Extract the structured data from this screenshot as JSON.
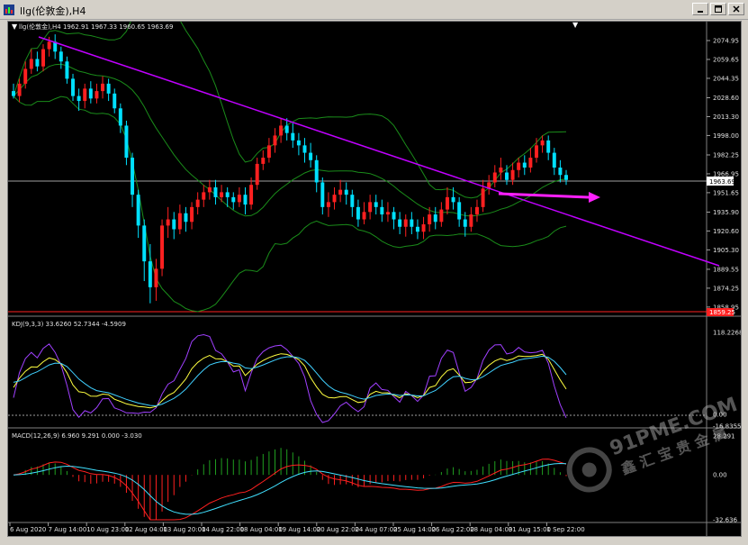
{
  "window": {
    "title": "llg(伦敦金),H4"
  },
  "header": {
    "symbol_info": "llg(伦敦金),H4  1962.91 1967.33 1960.65 1963.69"
  },
  "price_axis": {
    "ticks": [
      "2074.95",
      "2059.65",
      "2044.35",
      "2028.60",
      "2013.30",
      "1998.00",
      "1982.25",
      "1966.95",
      "1951.65",
      "1935.90",
      "1920.60",
      "1905.30",
      "1889.55",
      "1874.25",
      "1858.95"
    ],
    "current_price": "1963.69",
    "lower_red_label": "1859.25"
  },
  "time_axis": {
    "ticks": [
      "6 Aug 2020",
      "7 Aug 14:00",
      "10 Aug 23:00",
      "12 Aug 04:00",
      "13 Aug 20:00",
      "14 Aug 22:00",
      "18 Aug 04:00",
      "19 Aug 14:00",
      "20 Aug 22:00",
      "24 Aug 07:00",
      "25 Aug 14:00",
      "26 Aug 22:00",
      "28 Aug 04:00",
      "31 Aug 15:00",
      "1 Sep 22:00"
    ]
  },
  "kdj": {
    "label": "KDJ(9,3,3) 33.6260 52.7344 -4.5909",
    "ticks": [
      "118.2268",
      "0.00",
      "-16.8355"
    ]
  },
  "macd": {
    "label": "MACD(12,26,9) 6.960 9.291 0.000 -3.030",
    "ticks": [
      "28.291",
      "0.00",
      "-32.636"
    ]
  },
  "watermark": {
    "line1": "91PME.COM",
    "line2": "鑫 汇 宝 贵 金 属"
  },
  "colors": {
    "background": "#000000",
    "bull": "#ff2020",
    "bear": "#00e0ff",
    "trendline": "#c000ff",
    "arrow": "#ff20ff",
    "bands": "#1a8c1a",
    "k_line": "#ffff40",
    "d_line": "#40d0ff",
    "j_line": "#a040ff",
    "macd_line": "#ff2020",
    "signal_line": "#40e0ff",
    "hist_pos": "#20a020",
    "hist_neg": "#ff2020"
  },
  "candles": [
    [
      2034,
      2030,
      2040,
      2028
    ],
    [
      2030,
      2040,
      2044,
      2025
    ],
    [
      2040,
      2052,
      2058,
      2036
    ],
    [
      2052,
      2060,
      2068,
      2048
    ],
    [
      2060,
      2054,
      2066,
      2050
    ],
    [
      2054,
      2068,
      2072,
      2050
    ],
    [
      2068,
      2074,
      2078,
      2062
    ],
    [
      2074,
      2066,
      2080,
      2060
    ],
    [
      2066,
      2058,
      2070,
      2052
    ],
    [
      2058,
      2044,
      2062,
      2040
    ],
    [
      2044,
      2030,
      2048,
      2026
    ],
    [
      2030,
      2026,
      2036,
      2018
    ],
    [
      2026,
      2036,
      2040,
      2020
    ],
    [
      2036,
      2028,
      2042,
      2024
    ],
    [
      2028,
      2034,
      2040,
      2024
    ],
    [
      2034,
      2040,
      2046,
      2028
    ],
    [
      2040,
      2032,
      2044,
      2026
    ],
    [
      2032,
      2020,
      2036,
      2016
    ],
    [
      2020,
      2006,
      2024,
      2000
    ],
    [
      2006,
      1980,
      2010,
      1974
    ],
    [
      1980,
      1950,
      1984,
      1940
    ],
    [
      1950,
      1925,
      1954,
      1915
    ],
    [
      1925,
      1896,
      1930,
      1880
    ],
    [
      1896,
      1875,
      1910,
      1862
    ],
    [
      1875,
      1890,
      1898,
      1864
    ],
    [
      1890,
      1925,
      1930,
      1884
    ],
    [
      1925,
      1930,
      1940,
      1915
    ],
    [
      1930,
      1922,
      1936,
      1914
    ],
    [
      1922,
      1935,
      1942,
      1918
    ],
    [
      1935,
      1928,
      1940,
      1920
    ],
    [
      1928,
      1940,
      1944,
      1922
    ],
    [
      1940,
      1946,
      1952,
      1934
    ],
    [
      1946,
      1952,
      1958,
      1940
    ],
    [
      1952,
      1956,
      1962,
      1946
    ],
    [
      1956,
      1948,
      1962,
      1942
    ],
    [
      1948,
      1952,
      1958,
      1944
    ],
    [
      1952,
      1948,
      1956,
      1940
    ],
    [
      1948,
      1944,
      1952,
      1938
    ],
    [
      1944,
      1950,
      1956,
      1940
    ],
    [
      1950,
      1942,
      1956,
      1934
    ],
    [
      1942,
      1958,
      1964,
      1938
    ],
    [
      1958,
      1975,
      1980,
      1954
    ],
    [
      1975,
      1980,
      1986,
      1970
    ],
    [
      1980,
      1990,
      1996,
      1976
    ],
    [
      1990,
      1998,
      2004,
      1984
    ],
    [
      1998,
      2006,
      2012,
      1992
    ],
    [
      2006,
      2000,
      2012,
      1994
    ],
    [
      2000,
      1994,
      2008,
      1988
    ],
    [
      1994,
      1990,
      2000,
      1982
    ],
    [
      1990,
      1984,
      1996,
      1976
    ],
    [
      1984,
      1978,
      1992,
      1972
    ],
    [
      1978,
      1960,
      1982,
      1952
    ],
    [
      1960,
      1940,
      1964,
      1934
    ],
    [
      1940,
      1944,
      1952,
      1932
    ],
    [
      1944,
      1950,
      1956,
      1938
    ],
    [
      1950,
      1954,
      1962,
      1944
    ],
    [
      1954,
      1950,
      1960,
      1942
    ],
    [
      1950,
      1940,
      1954,
      1932
    ],
    [
      1940,
      1930,
      1946,
      1924
    ],
    [
      1930,
      1936,
      1944,
      1926
    ],
    [
      1936,
      1944,
      1950,
      1930
    ],
    [
      1944,
      1940,
      1950,
      1934
    ],
    [
      1940,
      1934,
      1946,
      1928
    ],
    [
      1934,
      1936,
      1944,
      1928
    ],
    [
      1936,
      1930,
      1940,
      1922
    ],
    [
      1930,
      1924,
      1936,
      1918
    ],
    [
      1924,
      1930,
      1934,
      1916
    ],
    [
      1930,
      1924,
      1936,
      1918
    ],
    [
      1924,
      1920,
      1930,
      1914
    ],
    [
      1920,
      1926,
      1932,
      1914
    ],
    [
      1926,
      1934,
      1940,
      1920
    ],
    [
      1934,
      1928,
      1940,
      1922
    ],
    [
      1928,
      1938,
      1944,
      1924
    ],
    [
      1938,
      1948,
      1956,
      1934
    ],
    [
      1948,
      1944,
      1956,
      1938
    ],
    [
      1944,
      1930,
      1948,
      1924
    ],
    [
      1930,
      1924,
      1936,
      1916
    ],
    [
      1924,
      1934,
      1940,
      1920
    ],
    [
      1934,
      1940,
      1946,
      1928
    ],
    [
      1940,
      1955,
      1962,
      1936
    ],
    [
      1955,
      1960,
      1966,
      1950
    ],
    [
      1960,
      1968,
      1974,
      1956
    ],
    [
      1968,
      1972,
      1980,
      1962
    ],
    [
      1968,
      1962,
      1974,
      1958
    ],
    [
      1962,
      1970,
      1976,
      1958
    ],
    [
      1970,
      1976,
      1980,
      1964
    ],
    [
      1976,
      1972,
      1982,
      1966
    ],
    [
      1972,
      1980,
      1988,
      1968
    ],
    [
      1980,
      1990,
      1996,
      1976
    ],
    [
      1990,
      1994,
      1998,
      1984
    ],
    [
      1994,
      1984,
      1998,
      1978
    ],
    [
      1984,
      1972,
      1988,
      1966
    ],
    [
      1972,
      1966,
      1978,
      1960
    ],
    [
      1966,
      1962,
      1970,
      1958
    ]
  ]
}
